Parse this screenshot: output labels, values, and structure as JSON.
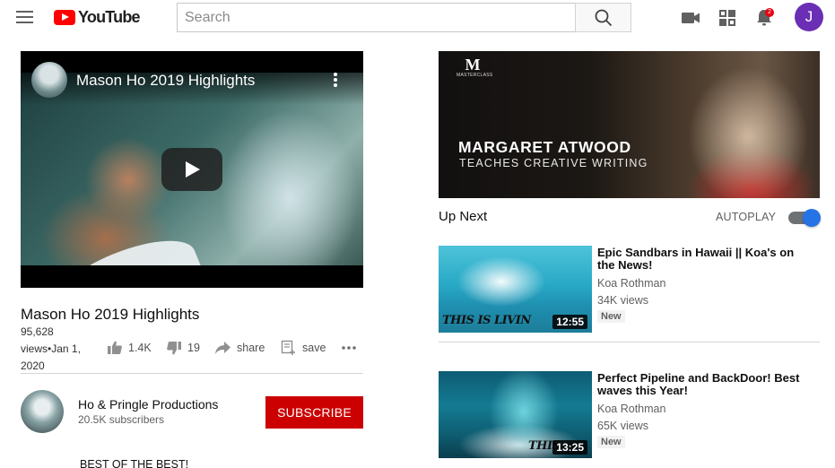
{
  "header": {
    "logo_text": "YouTube",
    "search_placeholder": "Search",
    "notification_count": "2",
    "avatar_letter": "J"
  },
  "player": {
    "title": "Mason Ho 2019 Highlights"
  },
  "video": {
    "title": "Mason Ho 2019 Highlights",
    "views_date": "95,628 views•Jan 1, 2020",
    "likes": "1.4K",
    "dislikes": "19",
    "share_label": "share",
    "save_label": "save"
  },
  "channel": {
    "name": "Ho & Pringle Productions",
    "subscribers": "20.5K subscribers",
    "subscribe_label": "SUBSCRIBE"
  },
  "description": {
    "first_line": "BEST OF THE BEST!"
  },
  "ad": {
    "brand": "M",
    "brand_sub": "MASTERCLASS",
    "headline": "MARGARET ATWOOD",
    "subheadline": "TEACHES CREATIVE WRITING"
  },
  "sidebar": {
    "up_next_label": "Up Next",
    "autoplay_label": "AUTOPLAY",
    "autoplay_on": true,
    "videos": [
      {
        "title": "Epic Sandbars in Hawaii || Koa's on the News!",
        "channel": "Koa Rothman",
        "views": "34K views",
        "badge": "New",
        "duration": "12:55",
        "thumb_tag": "THIS IS LIVIN"
      },
      {
        "title": "Perfect Pipeline and BackDoor! Best waves this Year!",
        "channel": "Koa Rothman",
        "views": "65K views",
        "badge": "New",
        "duration": "13:25",
        "thumb_tag": "THIS"
      }
    ]
  },
  "colors": {
    "brand_red": "#ff0000",
    "subscribe_red": "#cc0000",
    "toggle_blue": "#2673e6",
    "avatar_purple": "#6b2fb5"
  }
}
